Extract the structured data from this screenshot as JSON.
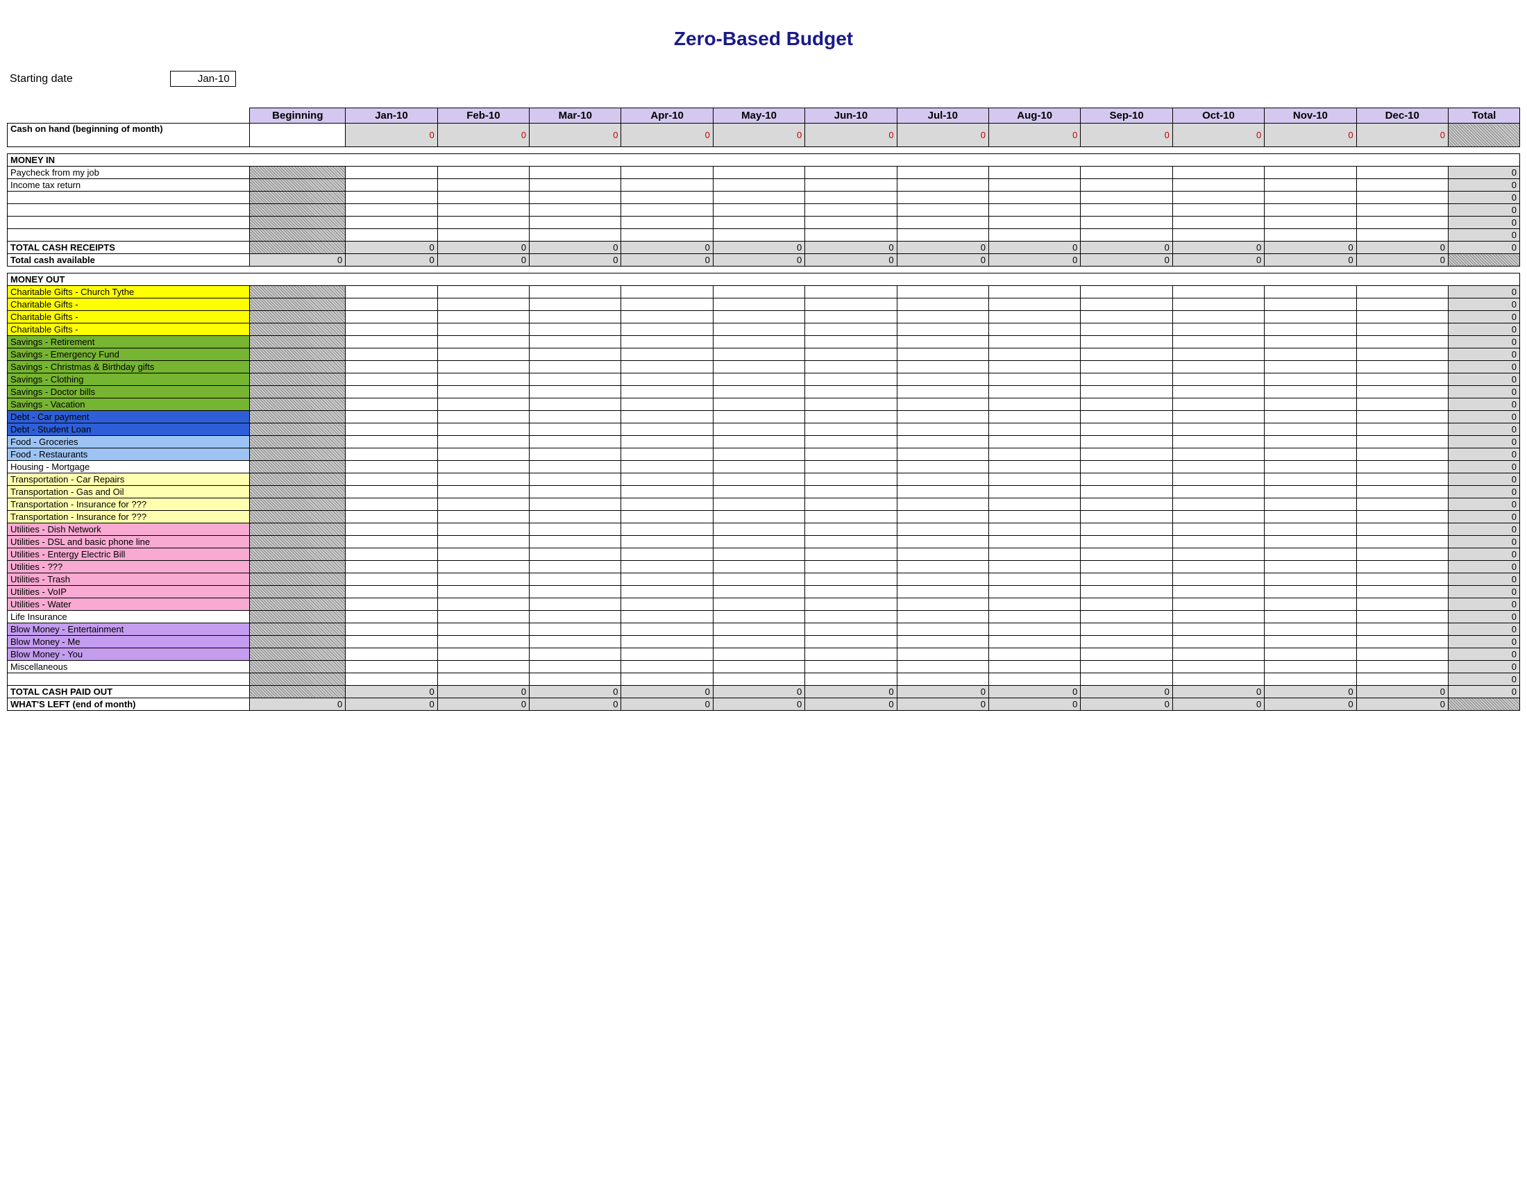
{
  "title": "Zero-Based Budget",
  "starting_date_label": "Starting date",
  "starting_date_value": "Jan-10",
  "columns": {
    "beginning": "Beginning",
    "months": [
      "Jan-10",
      "Feb-10",
      "Mar-10",
      "Apr-10",
      "May-10",
      "Jun-10",
      "Jul-10",
      "Aug-10",
      "Sep-10",
      "Oct-10",
      "Nov-10",
      "Dec-10"
    ],
    "total": "Total"
  },
  "cash_on_hand_label": "Cash on hand (beginning of month)",
  "cash_on_hand_values": [
    0,
    0,
    0,
    0,
    0,
    0,
    0,
    0,
    0,
    0,
    0,
    0
  ],
  "money_in": {
    "header": "MONEY IN",
    "rows": [
      {
        "label": "Paycheck from my job",
        "total": 0
      },
      {
        "label": "Income tax return",
        "total": 0
      },
      {
        "label": "",
        "total": 0
      },
      {
        "label": "",
        "total": 0
      },
      {
        "label": "",
        "total": 0
      },
      {
        "label": "",
        "total": 0
      }
    ],
    "total_receipts_label": "TOTAL CASH RECEIPTS",
    "total_receipts_values": [
      0,
      0,
      0,
      0,
      0,
      0,
      0,
      0,
      0,
      0,
      0,
      0,
      0
    ],
    "total_cash_available_label": "Total cash available",
    "total_cash_available_beginning": 0,
    "total_cash_available_values": [
      0,
      0,
      0,
      0,
      0,
      0,
      0,
      0,
      0,
      0,
      0,
      0
    ]
  },
  "money_out": {
    "header": "MONEY OUT",
    "rows": [
      {
        "label": "Charitable Gifts - Church Tythe",
        "color": "c-yellow",
        "total": 0
      },
      {
        "label": "Charitable Gifts -",
        "color": "c-yellow",
        "total": 0
      },
      {
        "label": "Charitable Gifts -",
        "color": "c-yellow",
        "total": 0
      },
      {
        "label": "Charitable Gifts -",
        "color": "c-yellow",
        "total": 0
      },
      {
        "label": "Savings - Retirement",
        "color": "c-green",
        "total": 0
      },
      {
        "label": "Savings - Emergency Fund",
        "color": "c-green",
        "total": 0
      },
      {
        "label": "Savings - Christmas & Birthday gifts",
        "color": "c-green",
        "total": 0
      },
      {
        "label": "Savings - Clothing",
        "color": "c-green",
        "total": 0
      },
      {
        "label": "Savings - Doctor bills",
        "color": "c-green",
        "total": 0
      },
      {
        "label": "Savings - Vacation",
        "color": "c-green",
        "total": 0
      },
      {
        "label": "Debt - Car payment",
        "color": "c-blue",
        "total": 0
      },
      {
        "label": "Debt - Student Loan",
        "color": "c-blue",
        "total": 0
      },
      {
        "label": "Food - Groceries",
        "color": "c-lightblue",
        "total": 0
      },
      {
        "label": "Food - Restaurants",
        "color": "c-lightblue",
        "total": 0
      },
      {
        "label": "Housing - Mortgage",
        "color": "c-white",
        "total": 0
      },
      {
        "label": "Transportation - Car Repairs",
        "color": "c-cream",
        "total": 0
      },
      {
        "label": "Transportation - Gas and Oil",
        "color": "c-cream",
        "total": 0
      },
      {
        "label": "Transportation - Insurance for ???",
        "color": "c-cream",
        "total": 0
      },
      {
        "label": "Transportation - Insurance for ???",
        "color": "c-cream",
        "total": 0
      },
      {
        "label": "Utilities - Dish Network",
        "color": "c-pink",
        "total": 0
      },
      {
        "label": "Utilities - DSL and basic phone line",
        "color": "c-pink",
        "total": 0
      },
      {
        "label": "Utilities - Entergy Electric Bill",
        "color": "c-pink",
        "total": 0
      },
      {
        "label": "Utilities - ???",
        "color": "c-pink",
        "total": 0
      },
      {
        "label": "Utilities - Trash",
        "color": "c-pink",
        "total": 0
      },
      {
        "label": "Utilities - VoIP",
        "color": "c-pink",
        "total": 0
      },
      {
        "label": "Utilities - Water",
        "color": "c-pink",
        "total": 0
      },
      {
        "label": "Life Insurance",
        "color": "c-white",
        "total": 0
      },
      {
        "label": "Blow Money - Entertainment",
        "color": "c-purple",
        "total": 0
      },
      {
        "label": "Blow Money - Me",
        "color": "c-purple",
        "total": 0
      },
      {
        "label": "Blow Money - You",
        "color": "c-purple",
        "total": 0
      },
      {
        "label": "Miscellaneous",
        "color": "c-white",
        "total": 0
      }
    ],
    "blank_row_total": 0,
    "total_paid_label": "TOTAL CASH PAID OUT",
    "total_paid_values": [
      0,
      0,
      0,
      0,
      0,
      0,
      0,
      0,
      0,
      0,
      0,
      0,
      0
    ],
    "whats_left_label": "WHAT'S LEFT (end of month)",
    "whats_left_beginning": 0,
    "whats_left_values": [
      0,
      0,
      0,
      0,
      0,
      0,
      0,
      0,
      0,
      0,
      0,
      0
    ]
  }
}
